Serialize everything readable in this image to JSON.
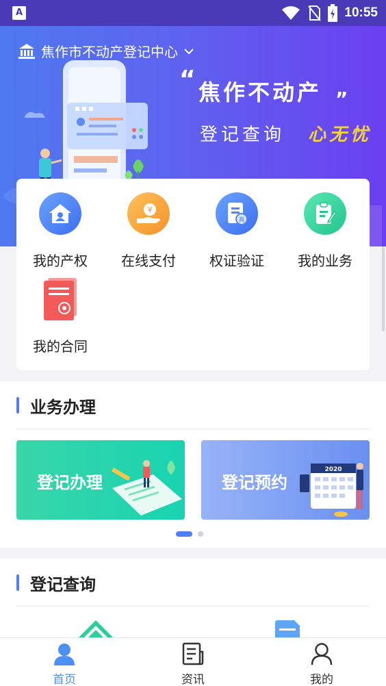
{
  "status_bar": {
    "time": "10:55",
    "app_indicator": "A"
  },
  "header": {
    "location": "焦作市不动产登记中心"
  },
  "banner": {
    "slogan_line1": "焦作不动产",
    "slogan_line2_left": "登记查询",
    "slogan_line2_right": "心无忧",
    "accent_color": "#f2d33a"
  },
  "quick_menu": {
    "items": [
      {
        "label": "我的产权",
        "icon": "house-icon",
        "color": "#4e84f7"
      },
      {
        "label": "在线支付",
        "icon": "yuan-hand-icon",
        "color": "#f7a23a"
      },
      {
        "label": "权证验证",
        "icon": "certificate-check-icon",
        "color": "#4e84f7"
      },
      {
        "label": "我的业务",
        "icon": "clipboard-edit-icon",
        "color": "#2ccf9a"
      },
      {
        "label": "我的合同",
        "icon": "contract-icon",
        "color": "#f25a5a"
      }
    ]
  },
  "business": {
    "title": "业务办理",
    "cards": [
      {
        "label": "登记办理"
      },
      {
        "label": "登记预约",
        "calendar_year": "2020"
      }
    ]
  },
  "query": {
    "title": "登记查询"
  },
  "bottom_nav": {
    "items": [
      {
        "label": "首页",
        "icon": "user-home-icon",
        "active": true
      },
      {
        "label": "资讯",
        "icon": "news-icon",
        "active": false
      },
      {
        "label": "我的",
        "icon": "profile-icon",
        "active": false
      }
    ],
    "active_color": "#4e8ff5"
  }
}
